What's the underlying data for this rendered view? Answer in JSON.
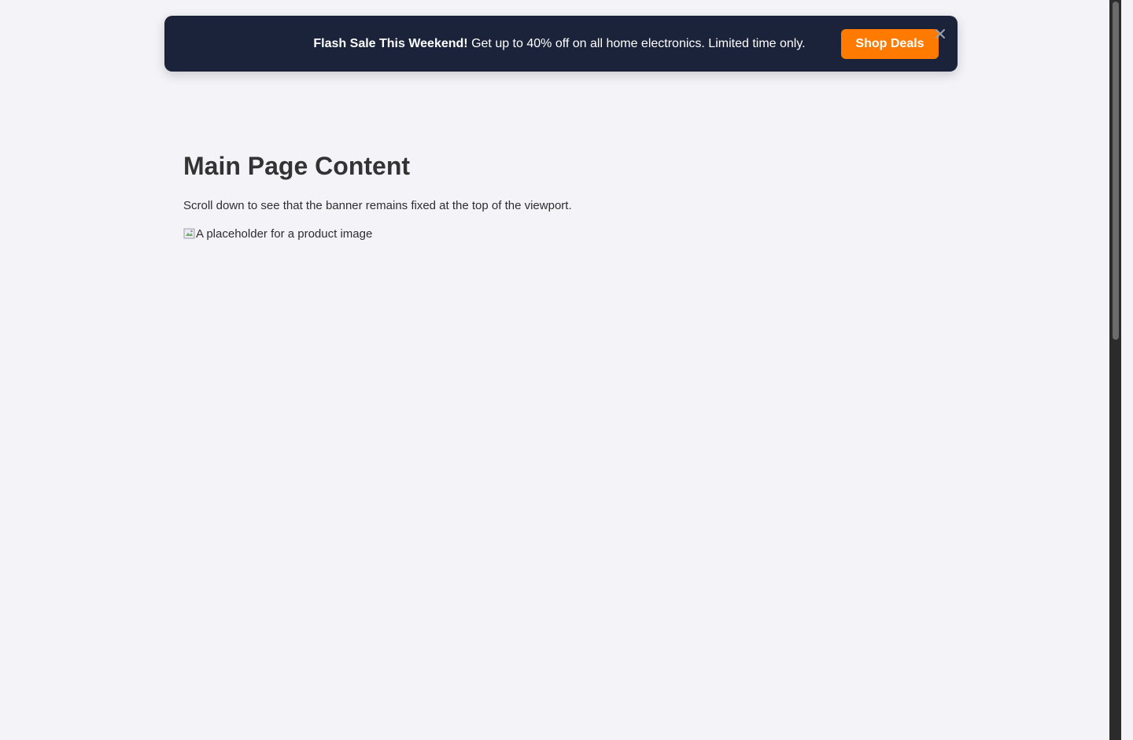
{
  "banner": {
    "headline": "Flash Sale This Weekend!",
    "message": "Get up to 40% off on all home electronics. Limited time only.",
    "cta_label": "Shop Deals",
    "close_label": "×",
    "close_icon": "close-icon",
    "background_color": "#1b233b",
    "cta_color": "#ff7a00"
  },
  "main": {
    "title": "Main Page Content",
    "description": "Scroll down to see that the banner remains fixed at the top of the viewport.",
    "image_alt": "A placeholder for a product image",
    "image_icon": "broken-image-icon"
  },
  "colors": {
    "page_background": "#f4f4f8",
    "scrollbar_track": "#2b2b2b",
    "scrollbar_thumb": "#6b6b6b"
  }
}
